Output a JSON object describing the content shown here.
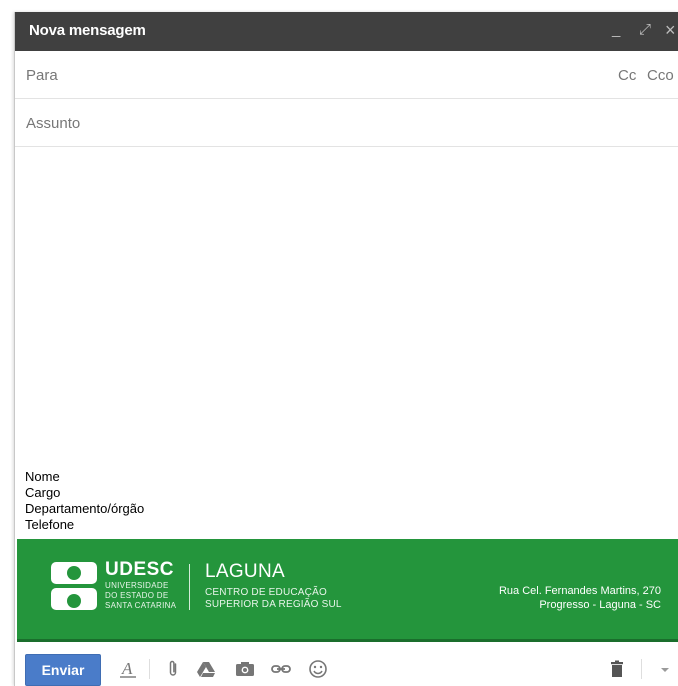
{
  "window": {
    "title": "Nova mensagem",
    "controls": {
      "minimize": "_",
      "expand": "⤢",
      "close": "×"
    }
  },
  "to_field": {
    "placeholder": "Para",
    "cc": "Cc",
    "bcc": "Cco"
  },
  "subject_field": {
    "placeholder": "Assunto"
  },
  "signature": {
    "lines": [
      "Nome",
      "Cargo",
      "Departamento/órgão",
      "Telefone"
    ]
  },
  "banner": {
    "brand": "UDESC",
    "brand_sub": [
      "UNIVERSIDADE",
      "DO ESTADO DE",
      "SANTA CATARINA"
    ],
    "campus": "LAGUNA",
    "campus_sub": [
      "CENTRO DE EDUCAÇÃO",
      "SUPERIOR DA REGIÃO SUL"
    ],
    "address": [
      "Rua Cel. Fernandes Martins, 270",
      "Progresso - Laguna - SC"
    ],
    "color": "#24953c"
  },
  "toolbar": {
    "send_label": "Enviar",
    "icons": [
      "text-format-icon",
      "attach-icon",
      "drive-icon",
      "photo-icon",
      "link-icon",
      "emoji-icon",
      "trash-icon",
      "more-options-icon"
    ],
    "accent": "#4a7cc9"
  }
}
